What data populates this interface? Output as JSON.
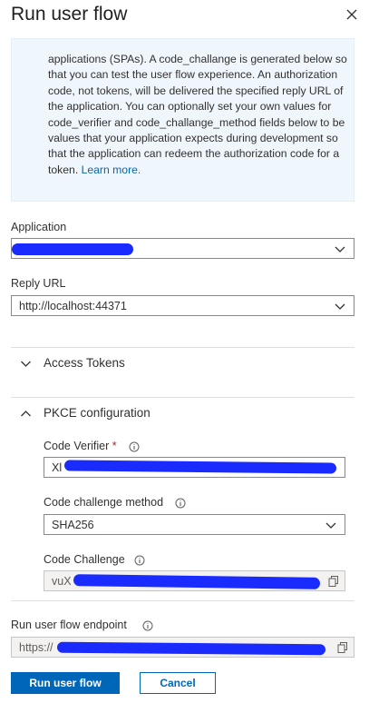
{
  "header": {
    "title": "Run user flow",
    "close_icon": "close-icon"
  },
  "info": {
    "text": "applications (SPAs). A code_challange is generated below so that you can test the user flow experience. An authorization code, not tokens, will be delivered the specified reply URL of the application. You can optionally set your own values for code_verifier and code_challange_method fields below to be values that your application expects during development so that the application can redeem the authorization code for a token.",
    "link": "Learn more."
  },
  "application": {
    "label": "Application",
    "value": ""
  },
  "reply_url": {
    "label": "Reply URL",
    "value": "http://localhost:44371"
  },
  "sections": {
    "access_tokens": {
      "label": "Access Tokens",
      "expanded": false
    },
    "pkce": {
      "label": "PKCE configuration",
      "expanded": true
    }
  },
  "pkce": {
    "code_verifier": {
      "label": "Code Verifier",
      "required_mark": "*",
      "value_prefix": "Xl"
    },
    "code_challenge_method": {
      "label": "Code challenge method",
      "value": "SHA256"
    },
    "code_challenge": {
      "label": "Code Challenge",
      "value_prefix": "vuX"
    }
  },
  "endpoint": {
    "label": "Run user flow endpoint",
    "value_prefix": "https://"
  },
  "buttons": {
    "run": "Run user flow",
    "cancel": "Cancel"
  },
  "colors": {
    "primary": "#0067b8",
    "info_bg": "#eff6fc",
    "redaction": "#1a2bff",
    "required": "#a4262c"
  }
}
